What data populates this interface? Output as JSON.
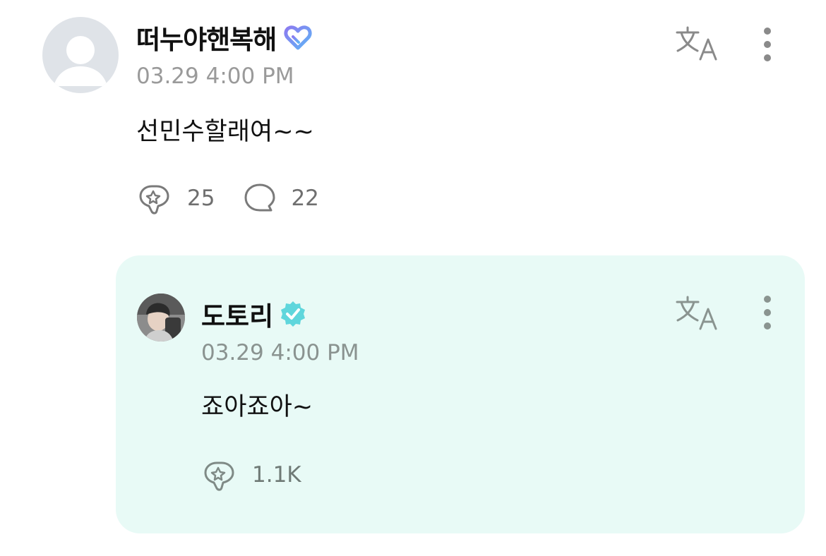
{
  "post": {
    "username": "떠누야핸복해",
    "timestamp": "03.29 4:00 PM",
    "content": "선민수할래여~~",
    "likes": "25",
    "comments": "22",
    "badge_icon": "heart-badge-icon",
    "badge_colors": [
      "#8b7bf0",
      "#5fb3f5"
    ]
  },
  "reply": {
    "username": "도토리",
    "timestamp": "03.29 4:00 PM",
    "content": "죠아죠아~",
    "likes": "1.1K",
    "badge_icon": "verified-badge-icon",
    "badge_color": "#5fd6dc",
    "background": "#e8faf6"
  },
  "icons": {
    "translate": "translate-icon",
    "more": "more-vertical-icon",
    "like": "like-icon",
    "comment": "comment-icon"
  }
}
